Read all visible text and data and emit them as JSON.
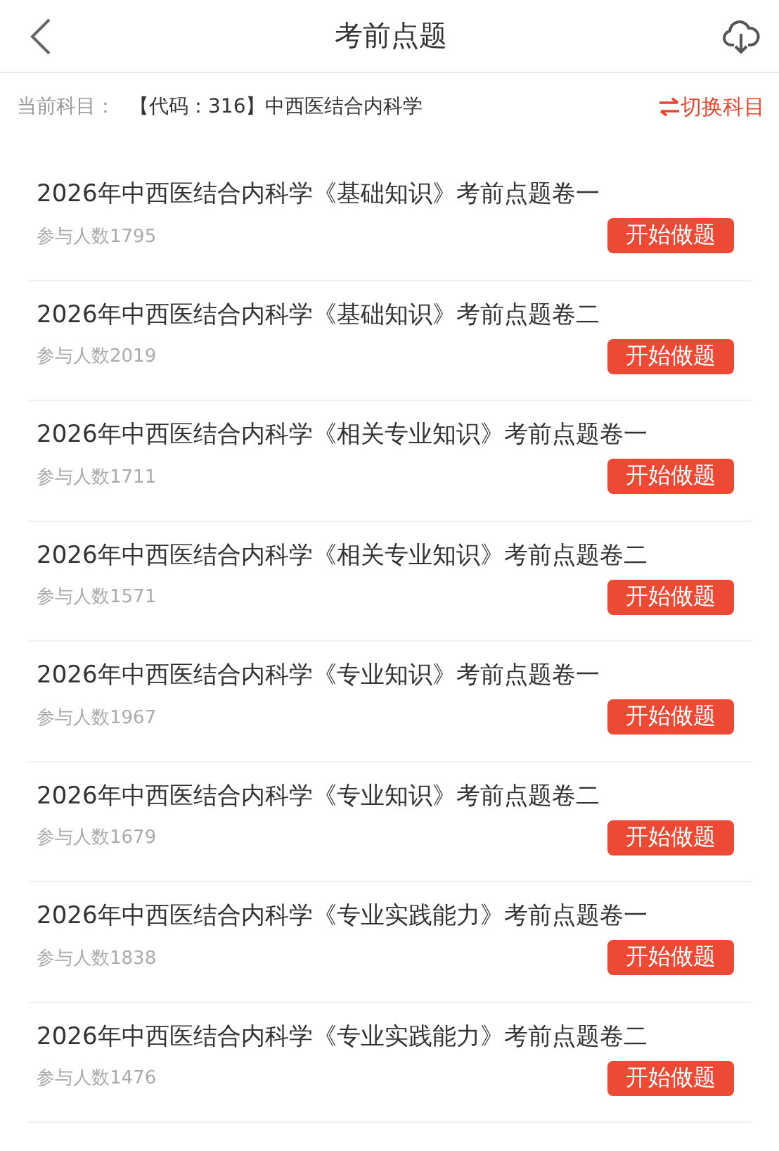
{
  "header": {
    "title": "考前点题"
  },
  "subject": {
    "label": "当前科目：",
    "value": "【代码：316】中西医结合内科学",
    "switch": "切换科目"
  },
  "papers": [
    {
      "title": "2026年中西医结合内科学《基础知识》考前点题卷一",
      "participants": "参与人数1795",
      "action": "开始做题"
    },
    {
      "title": "2026年中西医结合内科学《基础知识》考前点题卷二",
      "participants": "参与人数2019",
      "action": "开始做题"
    },
    {
      "title": "2026年中西医结合内科学《相关专业知识》考前点题卷一",
      "participants": "参与人数1711",
      "action": "开始做题"
    },
    {
      "title": "2026年中西医结合内科学《相关专业知识》考前点题卷二",
      "participants": "参与人数1571",
      "action": "开始做题"
    },
    {
      "title": "2026年中西医结合内科学《专业知识》考前点题卷一",
      "participants": "参与人数1967",
      "action": "开始做题"
    },
    {
      "title": "2026年中西医结合内科学《专业知识》考前点题卷二",
      "participants": "参与人数1679",
      "action": "开始做题"
    },
    {
      "title": "2026年中西医结合内科学《专业实践能力》考前点题卷一",
      "participants": "参与人数1838",
      "action": "开始做题"
    },
    {
      "title": "2026年中西医结合内科学《专业实践能力》考前点题卷二",
      "participants": "参与人数1476",
      "action": "开始做题"
    }
  ]
}
